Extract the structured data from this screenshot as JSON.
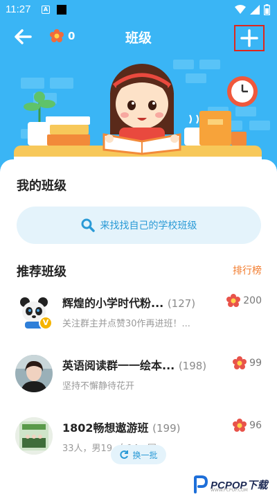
{
  "status_bar": {
    "time": "11:27",
    "a_icon": "A"
  },
  "nav": {
    "title": "班级",
    "coin_count": "0"
  },
  "my_class": {
    "title": "我的班级",
    "search_text": "来找找自己的学校班级"
  },
  "recommend": {
    "title": "推荐班级",
    "rank_label": "排行榜",
    "items": [
      {
        "name": "辉煌的小学时代粉...",
        "count": "(127)",
        "desc": "关注群主并点赞30作再进班！...",
        "score": "200",
        "badge": "V"
      },
      {
        "name": "英语阅读群一一绘本...",
        "count": "(198)",
        "desc": "坚持不懈静待花开",
        "score": "99"
      },
      {
        "name": "1802畅想遨游班",
        "count": "(199)",
        "desc": "33人，男19, 女14。团...",
        "score": "96"
      }
    ]
  },
  "refresh_label": "换一批",
  "watermark": {
    "text": "PCPOP下载",
    "sub": "WWW.PCPOP.COM"
  },
  "colors": {
    "header": "#3ab5f5",
    "accent_blue": "#2a9ad6",
    "rank_orange": "#f27b2c",
    "flower": "#e8534a"
  }
}
